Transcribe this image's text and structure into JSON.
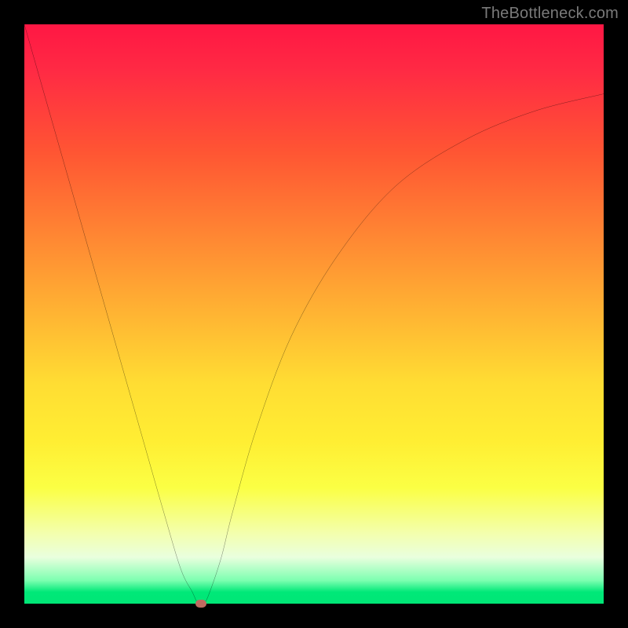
{
  "watermark": "TheBottleneck.com",
  "chart_data": {
    "type": "line",
    "title": "",
    "xlabel": "",
    "ylabel": "",
    "xlim": [
      0,
      100
    ],
    "ylim": [
      0,
      100
    ],
    "series": [
      {
        "name": "bottleneck-curve",
        "x": [
          0,
          4,
          8,
          12,
          16,
          20,
          24,
          27,
          29,
          30,
          31,
          32,
          34,
          36,
          40,
          46,
          54,
          64,
          76,
          88,
          100
        ],
        "values": [
          100,
          86,
          72,
          58,
          44,
          30,
          16,
          6,
          2,
          0,
          0,
          2,
          8,
          16,
          30,
          46,
          60,
          72,
          80,
          85,
          88
        ]
      }
    ],
    "marker": {
      "name": "optimum-point",
      "x": 30.5,
      "y": 0
    },
    "background_gradient": {
      "top": "#ff1744",
      "mid": "#ffd633",
      "bottom": "#00e676"
    }
  }
}
